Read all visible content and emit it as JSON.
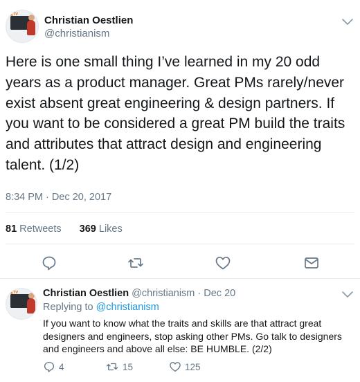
{
  "main_tweet": {
    "author_name": "Christian Oestlien",
    "author_handle": "@christianism",
    "text": "Here is one small thing I’ve learned in my 20 odd years as a product manager. Great PMs rarely/never exist absent great engineering & design partners. If you want to be considered a great PM build the traits and attributes that attract design and engineering talent. (1/2)",
    "timestamp": "8:34 PM · Dec 20, 2017",
    "retweets_count": "81",
    "retweets_label": "Retweets",
    "likes_count": "369",
    "likes_label": "Likes"
  },
  "reply_tweet": {
    "author_name": "Christian Oestlien",
    "meta": "@christianism · Dec 20",
    "replying_prefix": "Replying to",
    "replying_to": "@christianism",
    "text": "If you want to know what the traits and skills are that attract great designers and engineers, stop asking other PMs. Go talk to designers and engineers and above all else: BE HUMBLE. (2/2)",
    "reply_count": "4",
    "retweet_count": "15",
    "like_count": "125"
  },
  "icons": [
    "chevron-down-icon",
    "reply-icon",
    "retweet-icon",
    "like-icon",
    "message-icon"
  ],
  "colors": {
    "text": "#14171a",
    "muted": "#657786",
    "link": "#1b95e0",
    "divider": "#e6ecf0"
  }
}
